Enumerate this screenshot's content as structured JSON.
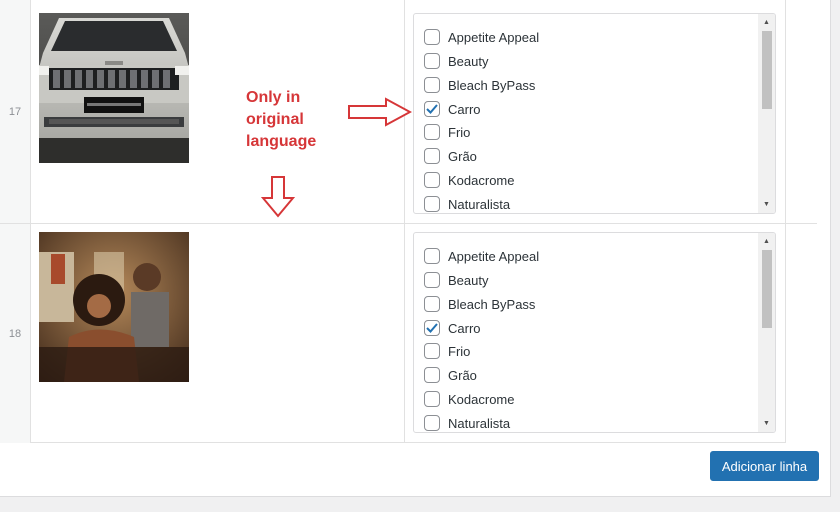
{
  "rows": [
    {
      "number": "17",
      "image": "jeep-commander-front",
      "options": [
        {
          "label": "Appetite Appeal",
          "checked": false
        },
        {
          "label": "Beauty",
          "checked": false
        },
        {
          "label": "Bleach ByPass",
          "checked": false
        },
        {
          "label": "Carro",
          "checked": true
        },
        {
          "label": "Frio",
          "checked": false
        },
        {
          "label": "Grão",
          "checked": false
        },
        {
          "label": "Kodacrome",
          "checked": false
        },
        {
          "label": "Naturalista",
          "checked": false
        }
      ]
    },
    {
      "number": "18",
      "image": "couple-portrait",
      "options": [
        {
          "label": "Appetite Appeal",
          "checked": false
        },
        {
          "label": "Beauty",
          "checked": false
        },
        {
          "label": "Bleach ByPass",
          "checked": false
        },
        {
          "label": "Carro",
          "checked": true
        },
        {
          "label": "Frio",
          "checked": false
        },
        {
          "label": "Grão",
          "checked": false
        },
        {
          "label": "Kodacrome",
          "checked": false
        },
        {
          "label": "Naturalista",
          "checked": false
        }
      ]
    }
  ],
  "annotation": {
    "line1": "Only in",
    "line2": "original",
    "line3": "language",
    "color": "#d63638"
  },
  "footer": {
    "add_row_label": "Adicionar linha"
  },
  "colors": {
    "accent": "#2271b1",
    "checkmark": "#2271b1"
  },
  "icons": [
    "check-icon",
    "arrow-right-icon",
    "arrow-down-icon",
    "scroll-up-icon",
    "scroll-down-icon"
  ]
}
